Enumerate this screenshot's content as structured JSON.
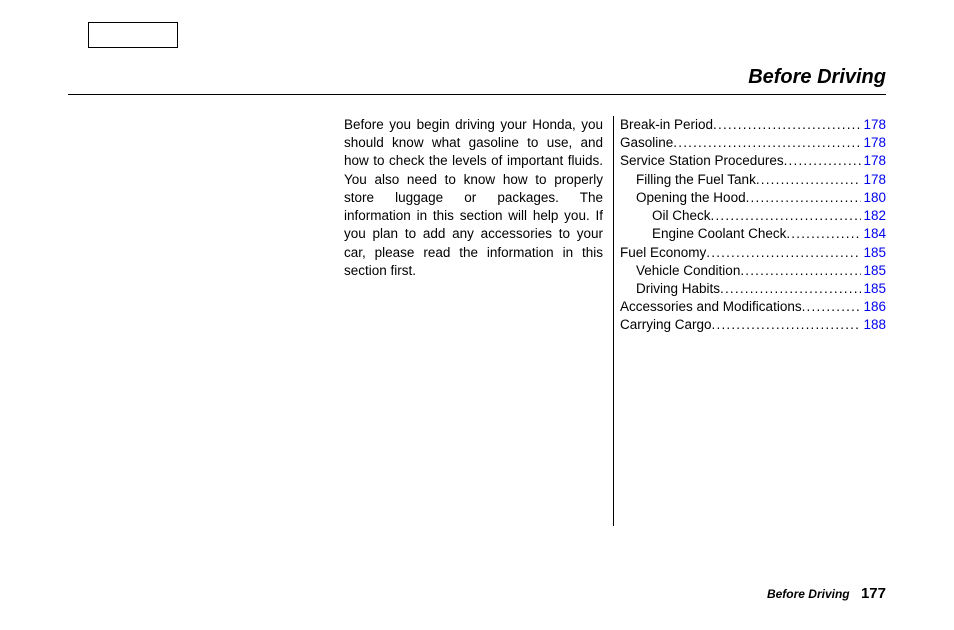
{
  "header": {
    "title": "Before Driving"
  },
  "intro": {
    "paragraph": "Before you begin driving your Honda, you should know what gasoline to use, and how to check the levels of important fluids. You also need to know how to properly store luggage or packages. The information in this section will help you. If you plan to add any accessories to your car, please read the information in this section first."
  },
  "toc": [
    {
      "label": "Break-in Period",
      "page": "178",
      "indent": 0
    },
    {
      "label": "Gasoline",
      "page": "178",
      "indent": 0
    },
    {
      "label": "Service Station Procedures",
      "page": "178",
      "indent": 0
    },
    {
      "label": "Filling the Fuel Tank",
      "page": "178",
      "indent": 1
    },
    {
      "label": "Opening the Hood",
      "page": "180",
      "indent": 1
    },
    {
      "label": "Oil Check",
      "page": "182",
      "indent": 2
    },
    {
      "label": "Engine Coolant Check",
      "page": "184",
      "indent": 2
    },
    {
      "label": "Fuel Economy",
      "page": "185",
      "indent": 0
    },
    {
      "label": "Vehicle Condition",
      "page": "185",
      "indent": 1
    },
    {
      "label": "Driving Habits",
      "page": "185",
      "indent": 1
    },
    {
      "label": "Accessories and Modifications",
      "page": "186",
      "indent": 0
    },
    {
      "label": "Carrying Cargo",
      "page": "188",
      "indent": 0
    }
  ],
  "footer": {
    "section": "Before Driving",
    "page": "177"
  },
  "dots": "............................................................"
}
